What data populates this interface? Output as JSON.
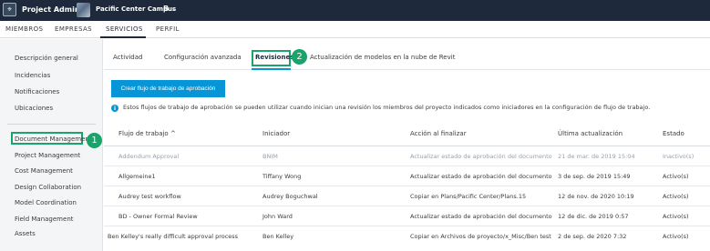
{
  "topbar": {
    "app_title": "Project Admin",
    "project_name": "Pacific Center Campus",
    "project_suffix": "B",
    "caret": "▾"
  },
  "tabs": [
    "MIEMBROS",
    "EMPRESAS",
    "SERVICIOS",
    "PERFIL"
  ],
  "active_tab": "SERVICIOS",
  "sidebar": {
    "items": [
      "Descripción general",
      "Incidencias",
      "Notificaciones",
      "Ubicaciones",
      "Document Management",
      "Project Management",
      "Cost Management",
      "Design Collaboration",
      "Model Coordination",
      "Field Management",
      "Assets"
    ],
    "highlighted": "Document Management"
  },
  "badges": {
    "one": "1",
    "two": "2"
  },
  "subtabs": [
    "Actividad",
    "Configuración avanzada",
    "Revisiones",
    "Actualización de modelos en la nube de Revit"
  ],
  "active_subtab": "Revisiones",
  "create_button": "Crear flujo de trabajo de aprobación",
  "info_text": "Estos flujos de trabajo de aprobación se pueden utilizar cuando inician una revisión los miembros del proyecto indicados como iniciadores en la configuración de flujo de trabajo.",
  "info_icon": "i",
  "table": {
    "headers": [
      "Flujo de trabajo",
      "Iniciador",
      "Acción al finalizar",
      "Última actualización",
      "Estado"
    ],
    "sort_indicator": "^",
    "rows": [
      [
        "Addendum Approval",
        "BNIM",
        "Actualizar estado de aprobación del documento",
        "21 de mar. de 2019 15:04",
        "Inactivo(s)"
      ],
      [
        "Allgemeine1",
        "Tiffany Wong",
        "Actualizar estado de aprobación del documento",
        "3 de sep. de 2019 15:49",
        "Activo(s)"
      ],
      [
        "Audrey test workflow",
        "Audrey Boguchwal",
        "Copiar en Plans/Pacific Center/Plans.15",
        "12 de nov. de 2020 10:19",
        "Activo(s)"
      ],
      [
        "BD - Owner Formal Review",
        "John Ward",
        "Actualizar estado de aprobación del documento",
        "12 de dic. de 2019 0:57",
        "Activo(s)"
      ],
      [
        "Ben Kelley's really difficult approval process",
        "Ben Kelley",
        "Copiar en Archivos de proyecto/x_Misc/Ben test",
        "2 de sep. de 2020 7:32",
        "Activo(s)"
      ]
    ]
  },
  "colors": {
    "topbar": "#1e2a3b",
    "accent": "#0696d7",
    "callout": "#1aa36a"
  }
}
